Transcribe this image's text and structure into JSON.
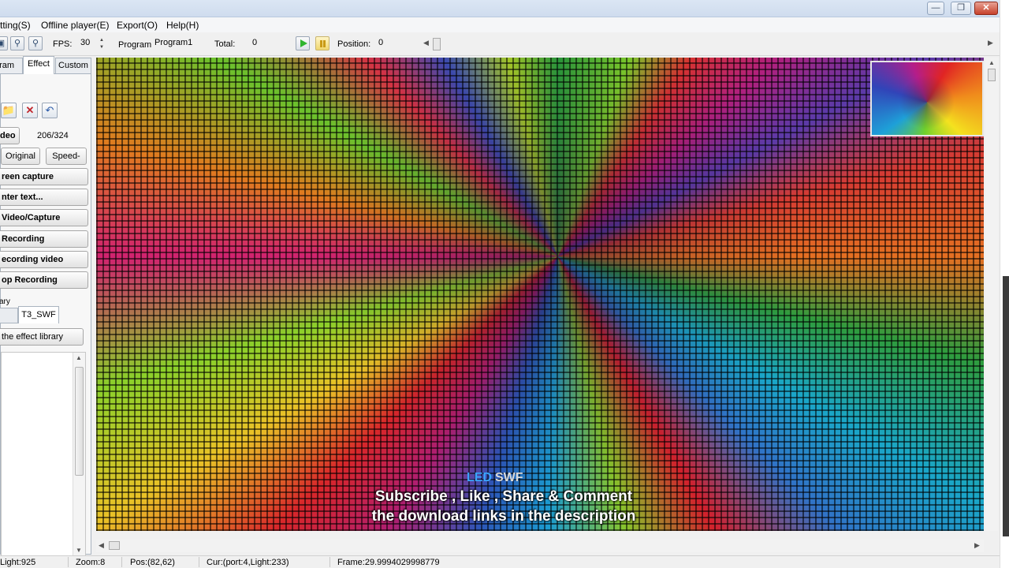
{
  "menu": {
    "items": [
      "tting(S)",
      "Offline player(E)",
      "Export(O)",
      "Help(H)"
    ]
  },
  "toolbar": {
    "fps_label": "FPS:",
    "fps_value": "30",
    "program_label": "Program:",
    "program_value": "Program1",
    "total_label": "Total:",
    "total_value": "0",
    "position_label": "Position:",
    "position_value": "0"
  },
  "left_panel": {
    "tabs": [
      "gram",
      "Effect",
      "Custom"
    ],
    "video_button": "deo",
    "frame_count": "206/324",
    "original_button": "Original",
    "speed_button": "Speed-",
    "action_buttons": [
      "reen capture",
      "nter text...",
      "Video/Capture",
      "Recording",
      "ecording video",
      "op Recording"
    ],
    "library_label": "ary",
    "library_tab": "T3_SWF",
    "library_button": "the effect library"
  },
  "canvas": {
    "watermark_led": "LED",
    "watermark_swf": "SWF",
    "caption_line1": "Subscribe , Like , Share & Comment",
    "caption_line2": "the download links in the description"
  },
  "status": {
    "light": "Light:925",
    "zoom": "Zoom:8",
    "pos": "Pos:(82,62)",
    "cur": "Cur:(port:4,Light:233)",
    "frame": "Frame:29.9994029998779"
  },
  "colors": {
    "title_bar": "#cfdcee",
    "close_button": "#c7412b",
    "play_green": "#2fb52f",
    "pause_yellow": "#f0d66e",
    "watermark_blue": "#3ba5ff"
  }
}
